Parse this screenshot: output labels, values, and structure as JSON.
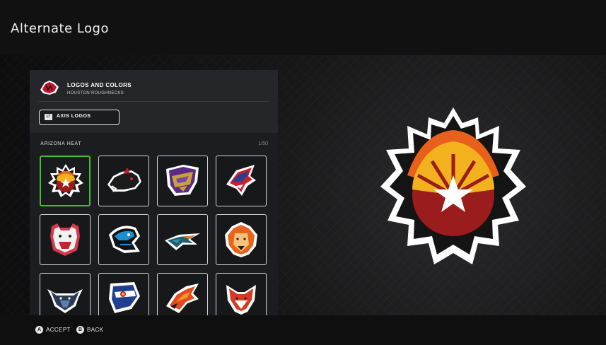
{
  "page": {
    "title": "Alternate Logo"
  },
  "panel": {
    "header_title": "LOGOS AND COLORS",
    "header_subtitle": "HOUSTON ROUGHNECKS",
    "axis_button": {
      "badge": "LT",
      "label": "AXIS LOGOS"
    },
    "section_title": "ARIZONA HEAT",
    "counter": "1/50"
  },
  "logo_grid": [
    {
      "name": "fire-basketball-star",
      "selected": true
    },
    {
      "name": "black-boar"
    },
    {
      "name": "purple-gold-crest"
    },
    {
      "name": "red-white-blue-shark"
    },
    {
      "name": "pink-bear"
    },
    {
      "name": "blue-serpent"
    },
    {
      "name": "teal-orange-bird"
    },
    {
      "name": "orange-lion"
    },
    {
      "name": "blue-bull"
    },
    {
      "name": "flag-shield"
    },
    {
      "name": "orange-phoenix"
    },
    {
      "name": "red-fox"
    }
  ],
  "footer": {
    "accept": {
      "button": "A",
      "label": "ACCEPT"
    },
    "back": {
      "button": "B",
      "label": "BACK"
    }
  },
  "colors": {
    "selected_border": "#42c02a",
    "panel_bg": "#1c1d20",
    "header_bg": "#25262a"
  }
}
